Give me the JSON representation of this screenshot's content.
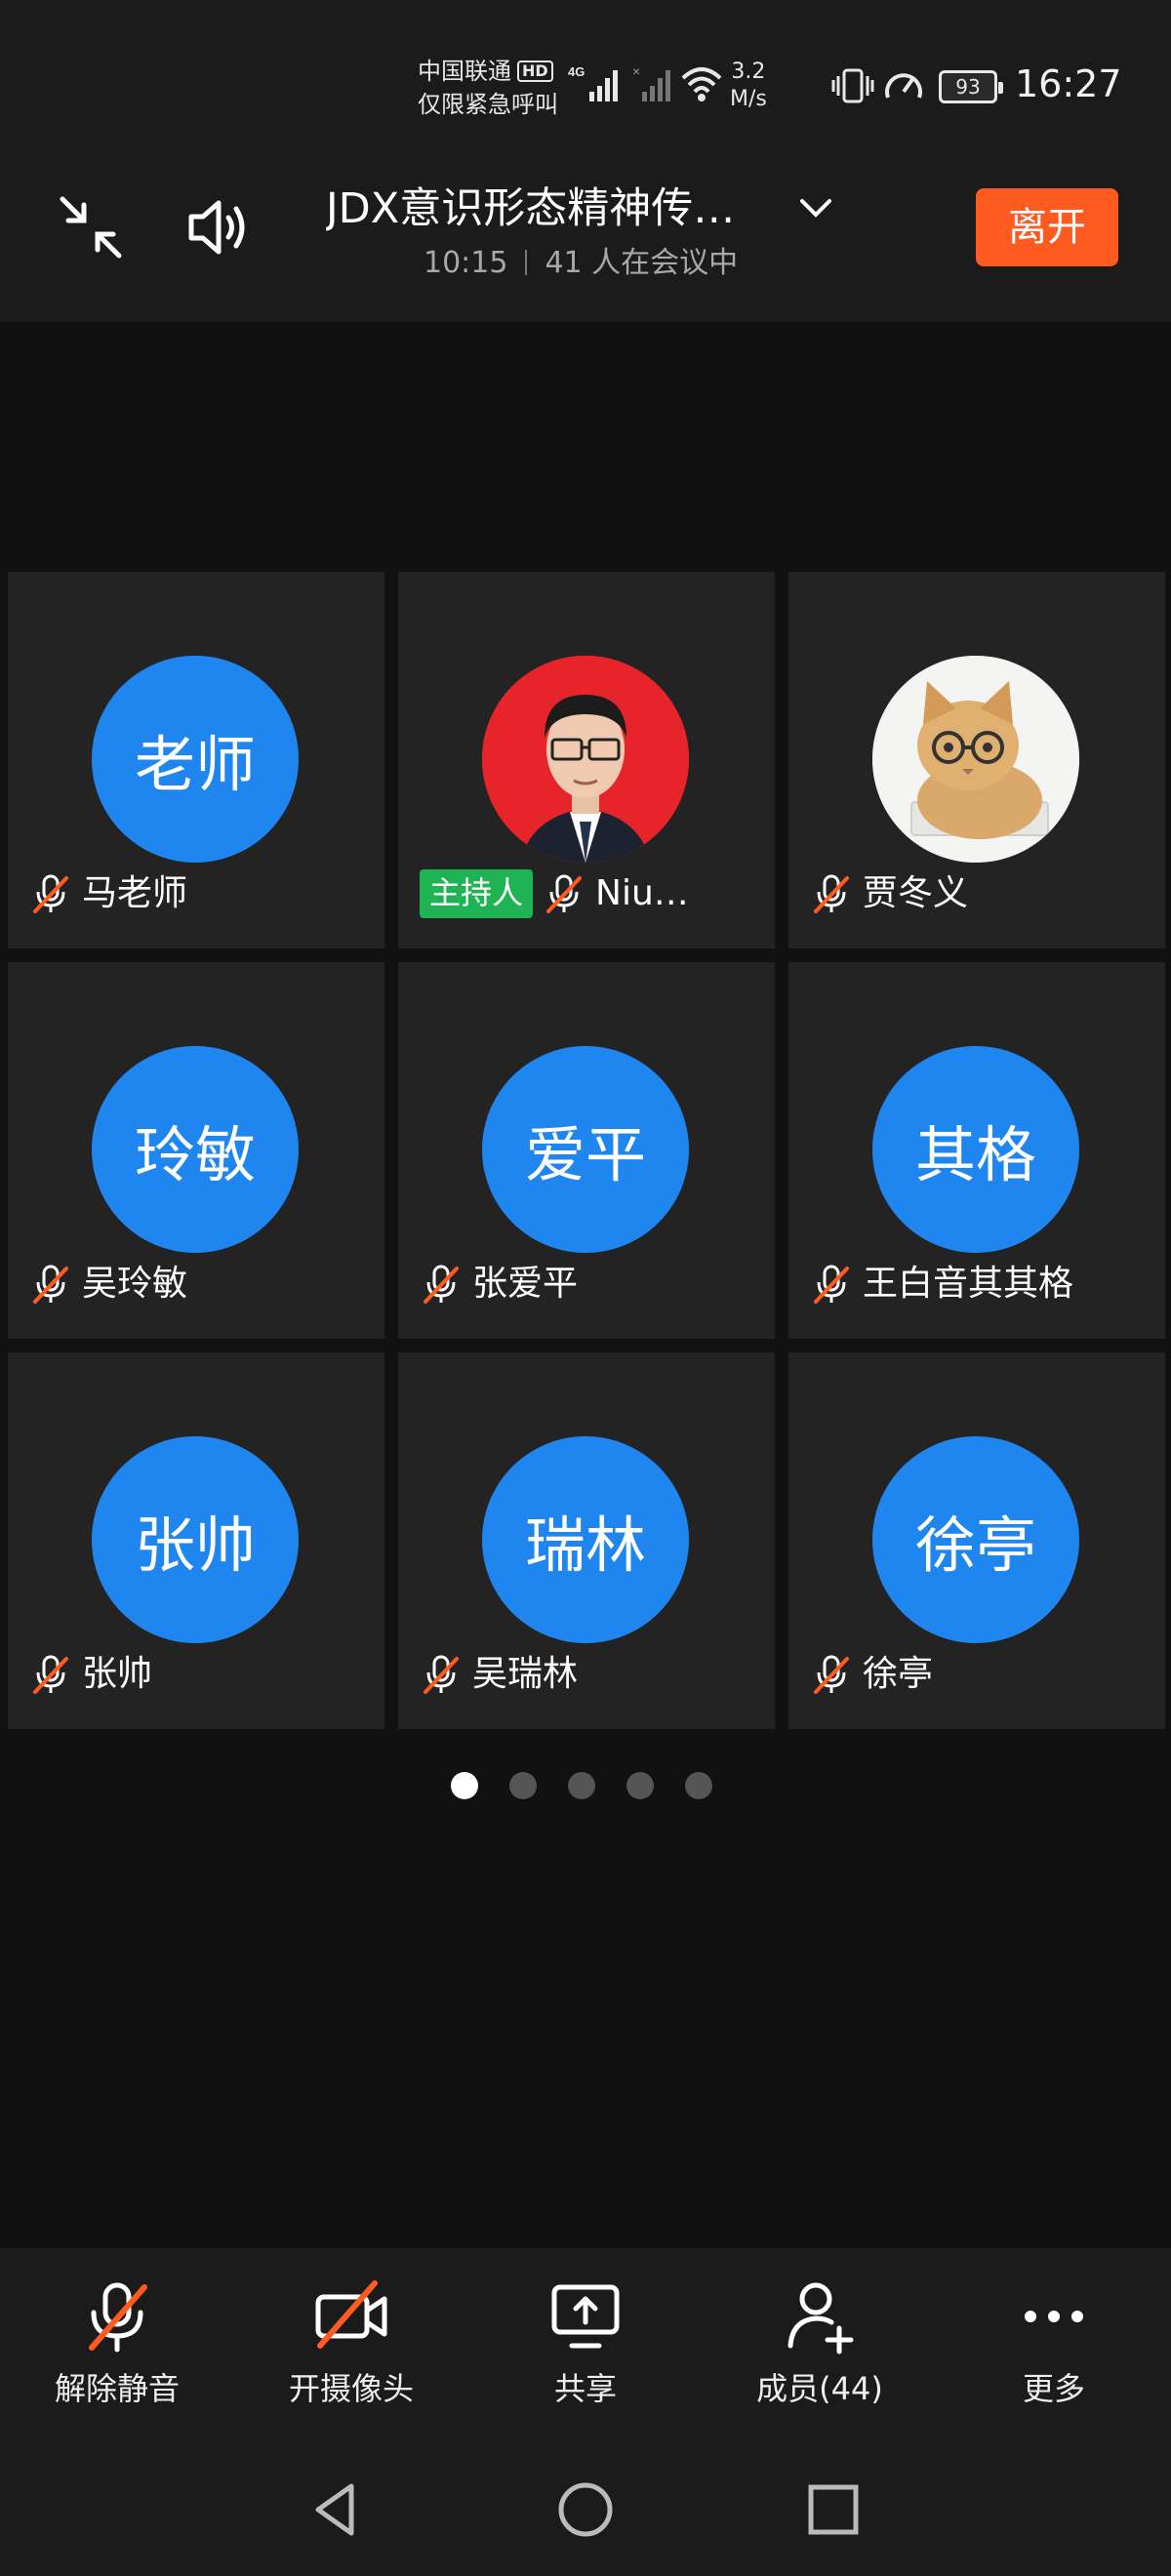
{
  "status_bar": {
    "carrier_line1": "中国联通",
    "hd_badge": "HD",
    "carrier_line2": "仅限紧急呼叫",
    "network_type": "4G",
    "speed_value": "3.2",
    "speed_unit": "M/s",
    "battery": "93",
    "time": "16:27"
  },
  "header": {
    "title": "JDX意识形态精神传…",
    "elapsed": "10:15",
    "participants_text": "41 人在会议中",
    "leave_label": "离开"
  },
  "participants": [
    {
      "avatar_text": "老师",
      "name": "马老师",
      "muted": true
    },
    {
      "avatar_text": "",
      "avatar_kind": "photo-man",
      "name": "Niu…",
      "host_badge": "主持人",
      "muted": true
    },
    {
      "avatar_text": "",
      "avatar_kind": "photo-cat",
      "name": "贾冬义",
      "muted": true
    },
    {
      "avatar_text": "玲敏",
      "name": "吴玲敏",
      "muted": true
    },
    {
      "avatar_text": "爱平",
      "name": "张爱平",
      "muted": true
    },
    {
      "avatar_text": "其格",
      "name": "王白音其其格",
      "muted": true
    },
    {
      "avatar_text": "张帅",
      "name": "张帅",
      "muted": true
    },
    {
      "avatar_text": "瑞林",
      "name": "吴瑞林",
      "muted": true
    },
    {
      "avatar_text": "徐亭",
      "name": "徐亭",
      "muted": true
    }
  ],
  "pagination": {
    "total": 5,
    "current": 1
  },
  "toolbar": {
    "unmute_label": "解除静音",
    "camera_label": "开摄像头",
    "share_label": "共享",
    "members_label": "成员(44)",
    "more_label": "更多"
  },
  "colors": {
    "avatar_blue": "#1f86f0",
    "leave_orange": "#ff5a1f",
    "host_green": "#1fb353",
    "mute_slash": "#ff5a1f"
  },
  "icons": [
    "exit-fullscreen-icon",
    "speaker-icon",
    "chevron-down-icon",
    "mic-muted-icon",
    "camera-off-icon",
    "share-screen-icon",
    "add-member-icon",
    "more-icon",
    "back-nav-icon",
    "home-nav-icon",
    "recents-nav-icon"
  ]
}
